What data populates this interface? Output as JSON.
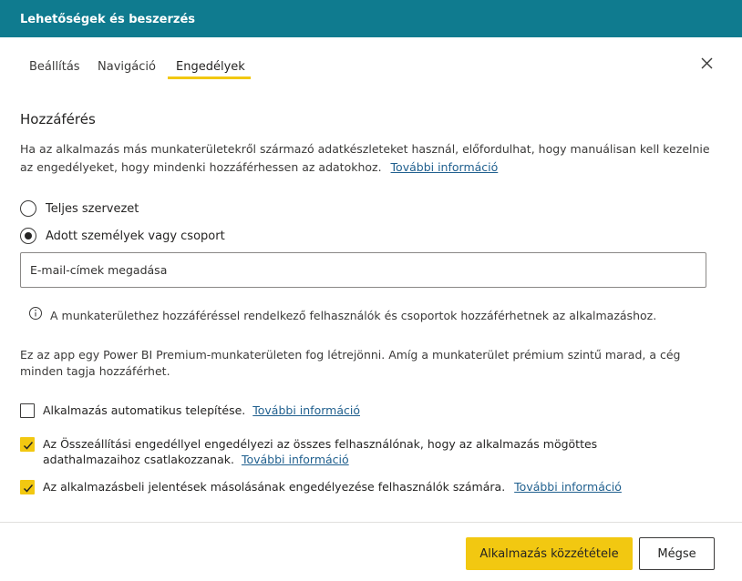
{
  "dialog": {
    "title": "Lehetőségek és beszerzés"
  },
  "tabs": [
    {
      "label": "Beállítás",
      "active": false
    },
    {
      "label": "Navigáció",
      "active": false
    },
    {
      "label": "Engedélyek",
      "active": true
    }
  ],
  "access": {
    "heading": "Hozzáférés",
    "description": "Ha az alkalmazás más munkaterületekről származó adatkészleteket használ, előfordulhat, hogy manuálisan kell kezelnie az engedélyeket, hogy mindenki hozzáférhessen az adatokhoz.",
    "more_info": "További információ",
    "options": [
      {
        "label": "Teljes szervezet",
        "selected": false
      },
      {
        "label": "Adott személyek vagy csoport",
        "selected": true
      }
    ],
    "email_placeholder": "E-mail-címek megadása",
    "info_note": "A munkaterülethez hozzáféréssel rendelkező felhasználók és csoportok hozzáférhetnek az alkalmazáshoz.",
    "premium_note": "Ez az app egy Power BI Premium-munkaterületen fog létrejönni. Amíg a munkaterület prémium szintű marad, a cég minden tagja hozzáférhet."
  },
  "checkboxes": [
    {
      "label": "Alkalmazás automatikus telepítése.",
      "link": "További információ",
      "checked": false
    },
    {
      "label": "Az Összeállítási engedéllyel engedélyezi az összes felhasználónak, hogy az alkalmazás mögöttes adathalmazaihoz csatlakozzanak.",
      "link": "További információ",
      "checked": true
    },
    {
      "label": "Az alkalmazásbeli jelentések másolásának engedélyezése felhasználók számára.",
      "link": "További információ",
      "checked": true
    }
  ],
  "footer": {
    "publish_label": "Alkalmazás közzététele",
    "cancel_label": "Mégse"
  },
  "colors": {
    "titlebar": "#0f7b8f",
    "accent": "#f2c811",
    "link": "#1f5f8e"
  }
}
